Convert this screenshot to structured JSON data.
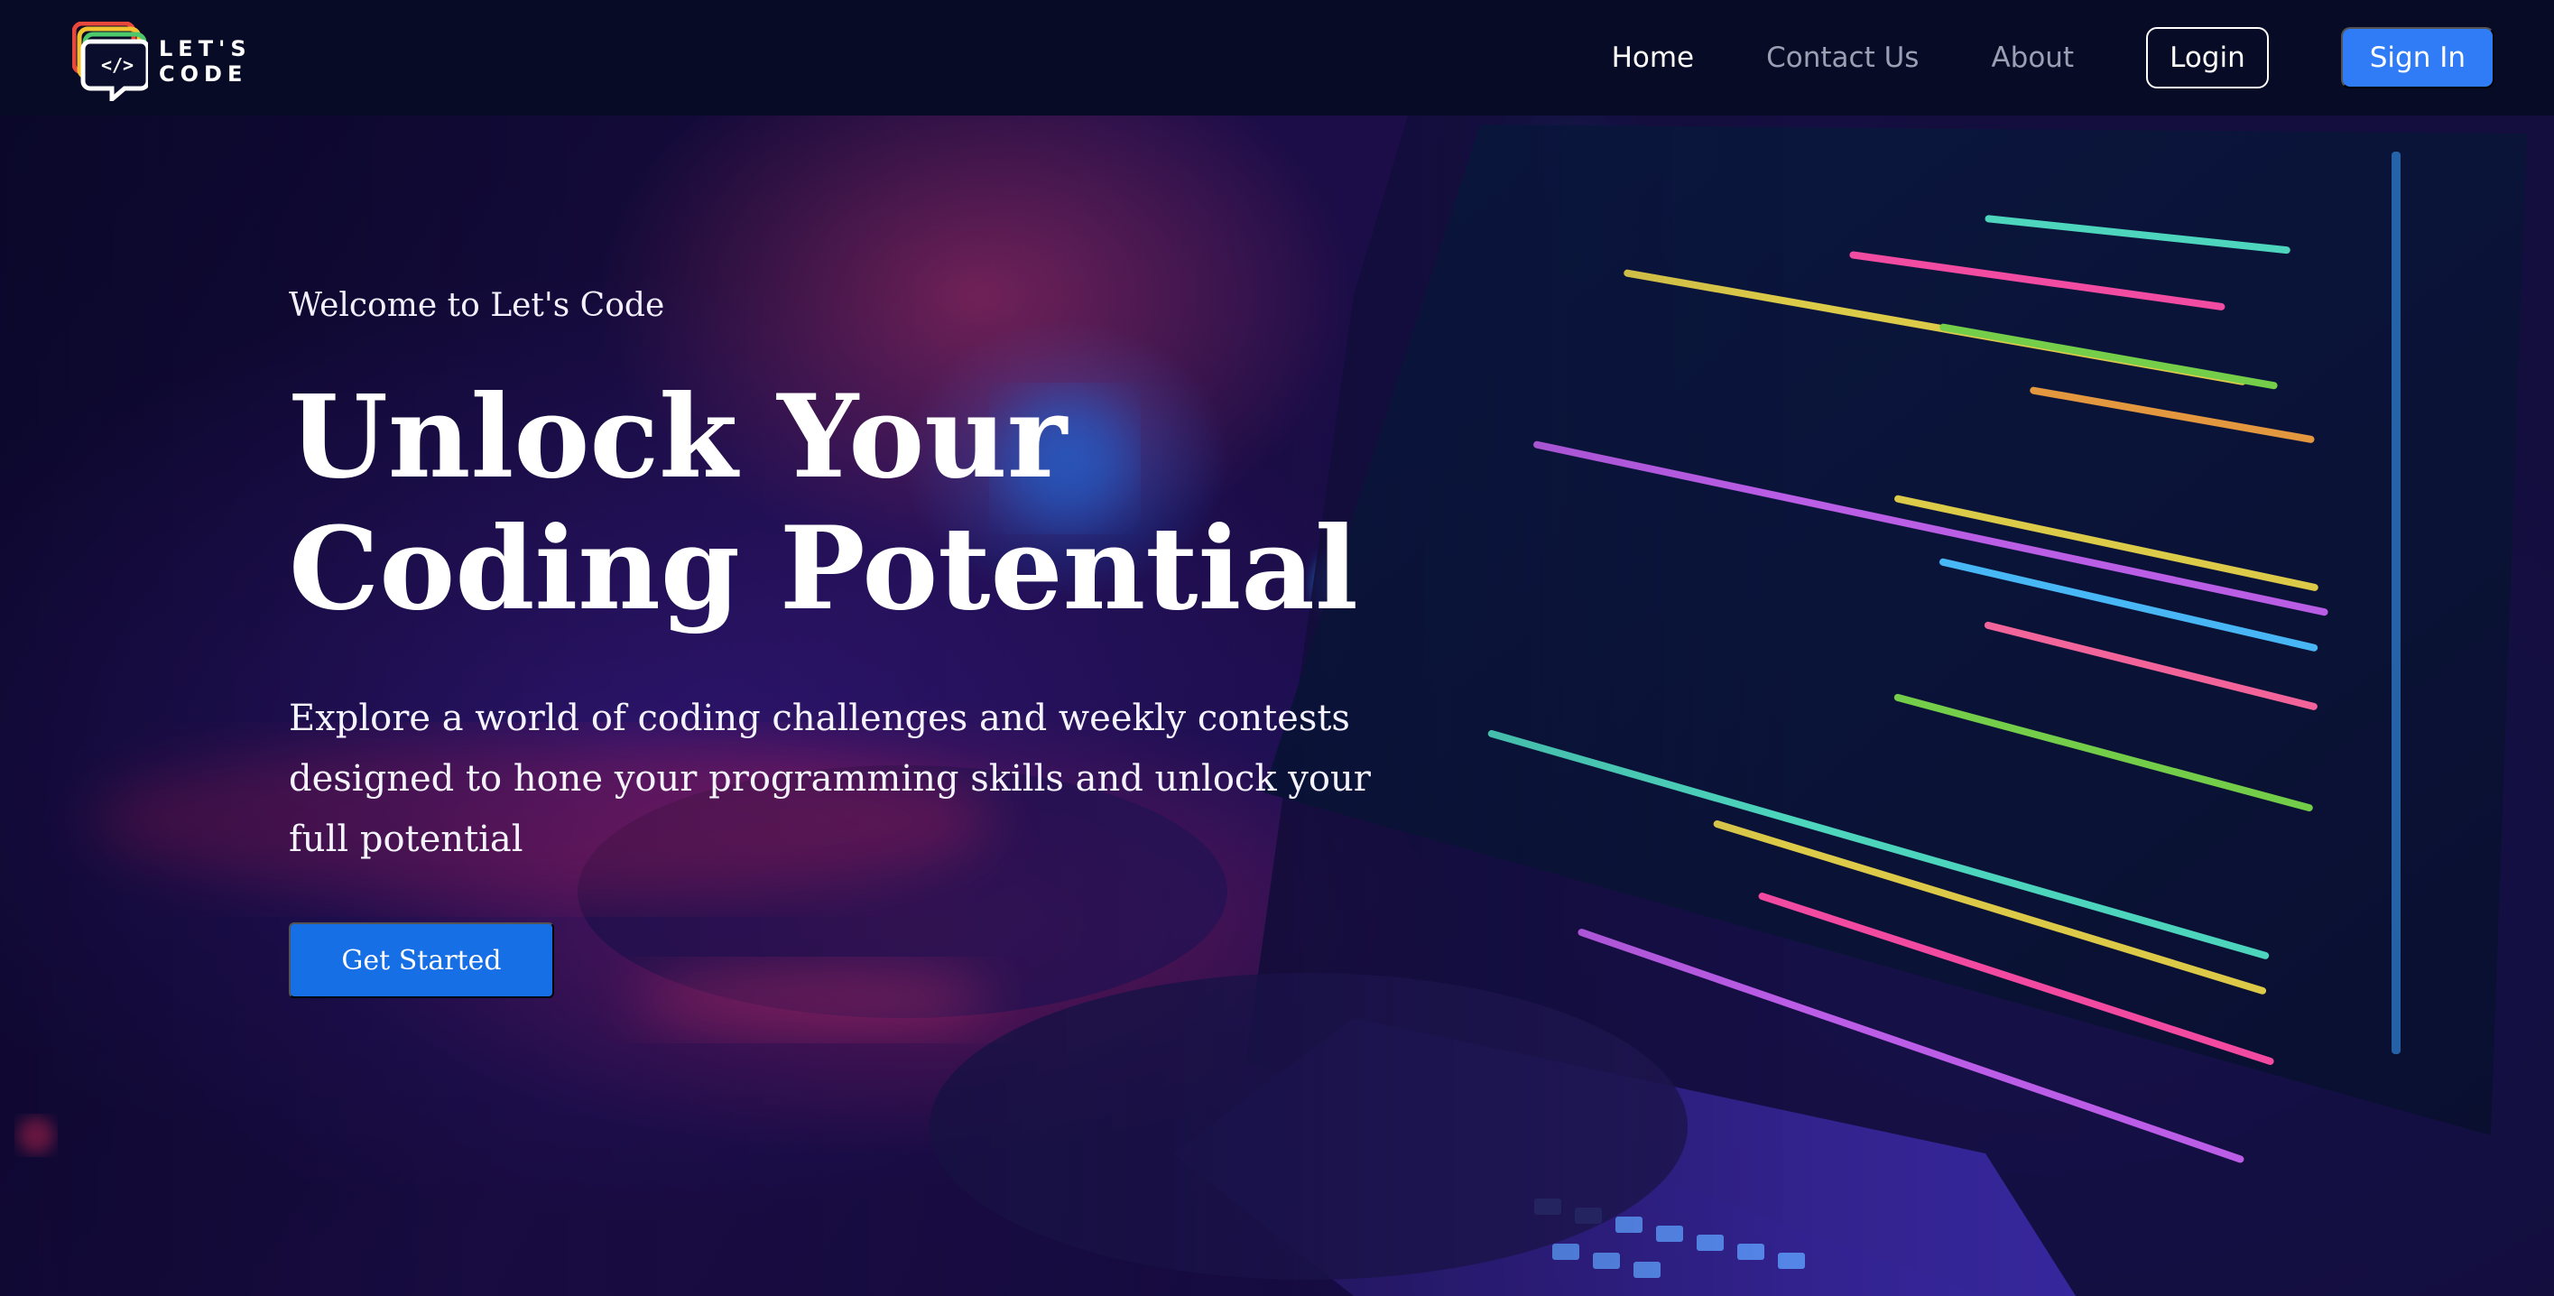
{
  "brand": {
    "name": "LET'S CODE",
    "logo_icon": "code-chat-bubble-icon",
    "logo_colors": [
      "#e8473c",
      "#f2c230",
      "#4cc96b",
      "#3d8cf0"
    ]
  },
  "nav": {
    "links": [
      {
        "label": "Home",
        "active": true
      },
      {
        "label": "Contact Us",
        "active": false
      },
      {
        "label": "About",
        "active": false
      }
    ],
    "login_label": "Login",
    "signin_label": "Sign In"
  },
  "hero": {
    "eyebrow": "Welcome to Let's Code",
    "headline": "Unlock Your Coding Potential",
    "subtext": "Explore a world of coding challenges and weekly contests designed to hone your programming skills and unlock your full potential",
    "cta_label": "Get Started"
  },
  "colors": {
    "nav_bg": "#080b26",
    "accent": "#2f7cf6",
    "cta": "#176fe6"
  }
}
